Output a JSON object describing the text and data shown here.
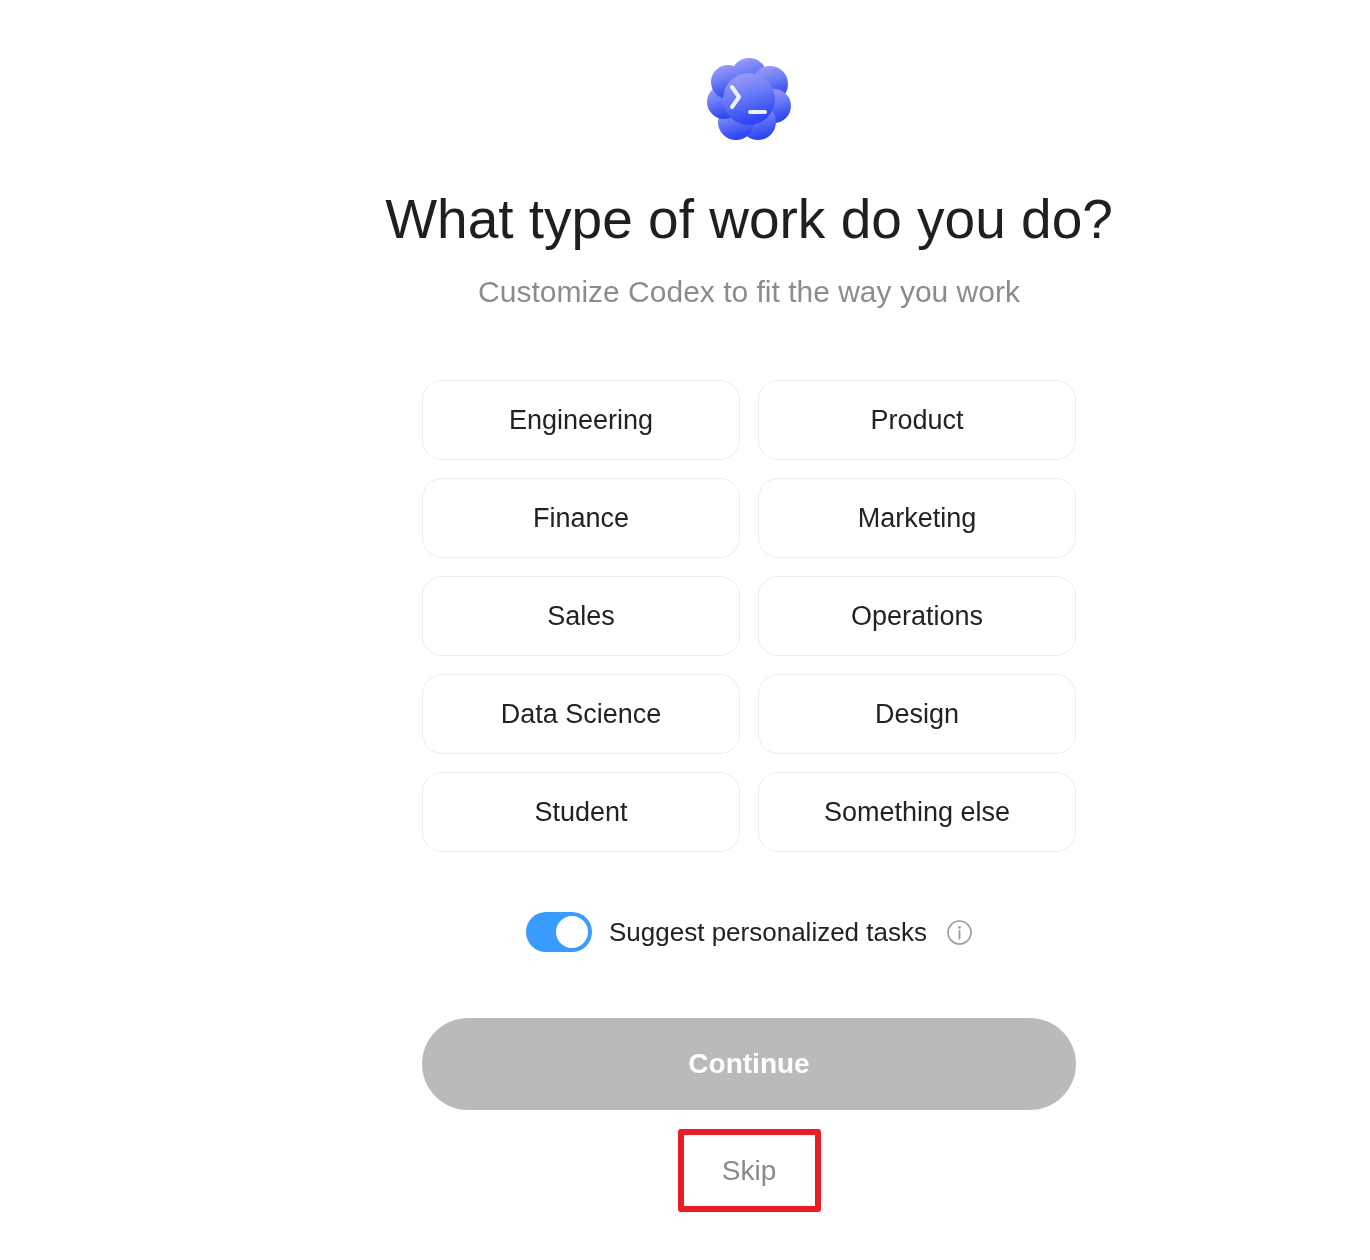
{
  "header": {
    "title": "What type of work do you do?",
    "subtitle": "Customize Codex to fit the way you work"
  },
  "options": [
    {
      "label": "Engineering",
      "selected": false
    },
    {
      "label": "Product",
      "selected": false
    },
    {
      "label": "Finance",
      "selected": false
    },
    {
      "label": "Marketing",
      "selected": false
    },
    {
      "label": "Sales",
      "selected": false
    },
    {
      "label": "Operations",
      "selected": false
    },
    {
      "label": "Data Science",
      "selected": false
    },
    {
      "label": "Design",
      "selected": false
    },
    {
      "label": "Student",
      "selected": false
    },
    {
      "label": "Something else",
      "selected": false
    }
  ],
  "suggest_toggle": {
    "label": "Suggest personalized tasks",
    "on": true
  },
  "continue_button": {
    "label": "Continue",
    "disabled": true
  },
  "skip_button": {
    "label": "Skip",
    "highlighted": true
  }
}
